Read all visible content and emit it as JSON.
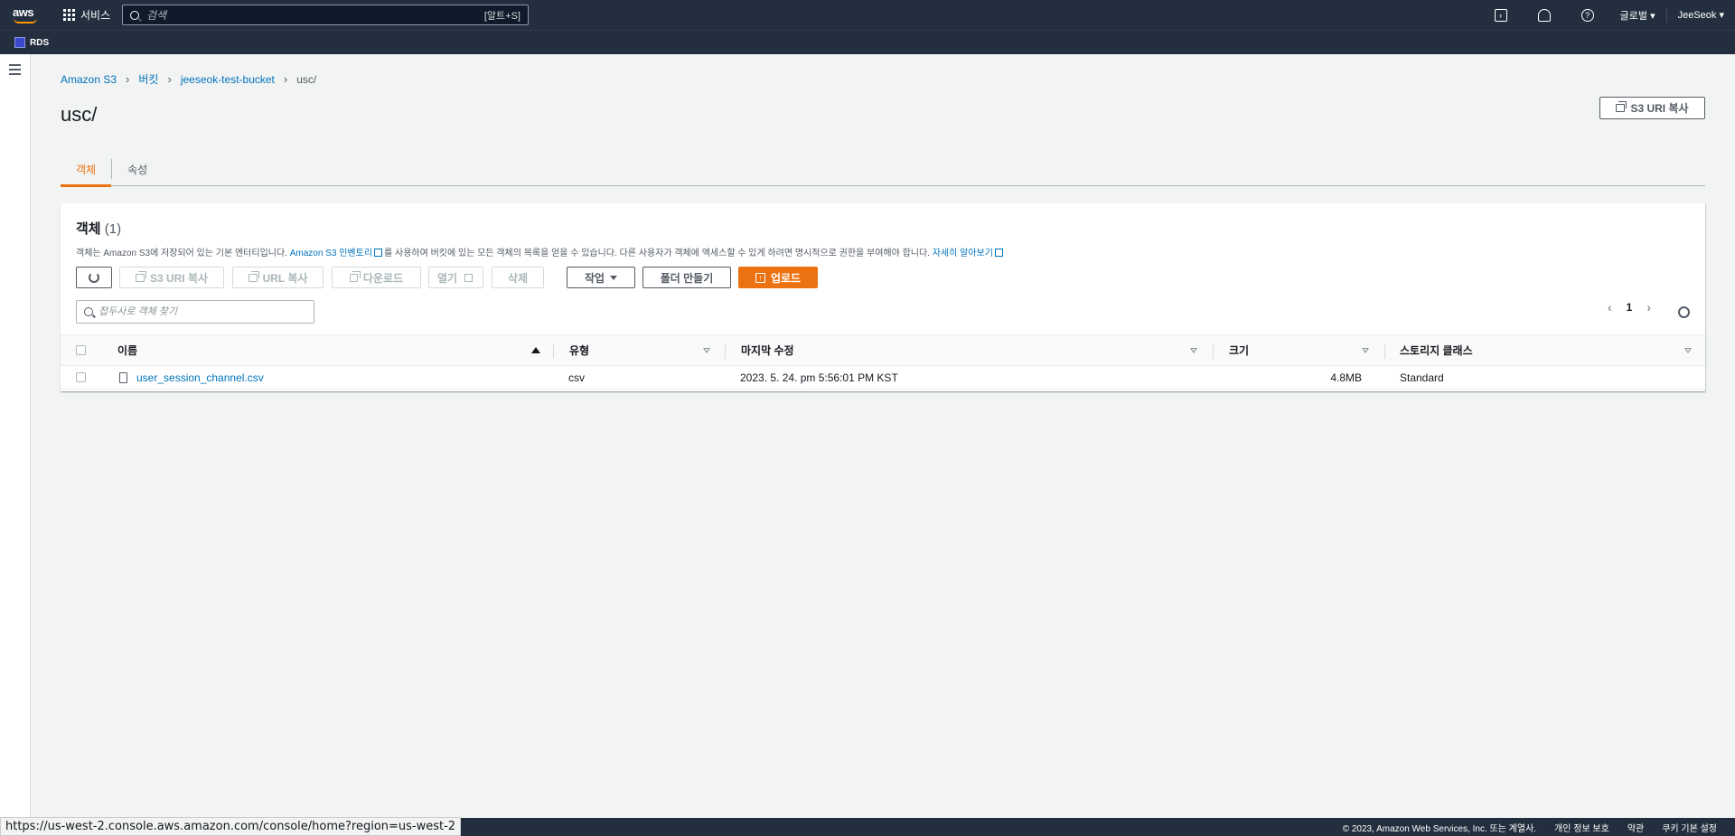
{
  "topnav": {
    "logo": "aws",
    "services_label": "서비스",
    "search_placeholder": "검색",
    "search_shortcut": "[알트+S]",
    "region_label": "글로벌 ▾",
    "user_label": "JeeSeok ▾"
  },
  "subnav": {
    "pinned_service": "RDS"
  },
  "breadcrumb": [
    "Amazon S3",
    "버킷",
    "jeeseok-test-bucket",
    "usc/"
  ],
  "page": {
    "title": "usc/",
    "copy_s3_uri": "S3 URI 복사"
  },
  "tabs": [
    {
      "label": "객체",
      "active": true
    },
    {
      "label": "속성",
      "active": false
    }
  ],
  "panel": {
    "title": "객체",
    "count": "(1)",
    "desc_prefix": "객체는 Amazon S3에 저장되어 있는 기본 엔터티입니다. ",
    "desc_link1": "Amazon S3 인벤토리",
    "desc_middle": "를 사용하여 버킷에 있는 모든 객체의 목록을 얻을 수 있습니다. 다른 사용자가 객체에 액세스할 수 있게 하려면 명시적으로 권한을 부여해야 합니다. ",
    "desc_link2": "자세히 알아보기",
    "buttons": {
      "copy_s3_uri": "S3 URI 복사",
      "copy_url": "URL 복사",
      "download": "다운로드",
      "open": "열기",
      "delete": "삭제",
      "actions": "작업",
      "create_folder": "폴더 만들기",
      "upload": "업로드"
    },
    "filter_placeholder": "접두사로 객체 찾기",
    "page_number": "1",
    "columns": [
      "이름",
      "유형",
      "마지막 수정",
      "크기",
      "스토리지 클래스"
    ],
    "rows": [
      {
        "name": "user_session_channel.csv",
        "type": "csv",
        "modified": "2023. 5. 24. pm 5:56:01 PM KST",
        "size": "4.8MB",
        "storage_class": "Standard"
      }
    ]
  },
  "footer": {
    "copyright": "© 2023, Amazon Web Services, Inc. 또는 계열사.",
    "privacy": "개인 정보 보호",
    "terms": "약관",
    "cookies": "쿠키 기본 설정"
  },
  "status_url": "https://us-west-2.console.aws.amazon.com/console/home?region=us-west-2",
  "colors": {
    "nav_bg": "#232f3e",
    "accent": "#ec7211",
    "link": "#0073bb",
    "page_bg": "#f2f3f3"
  }
}
